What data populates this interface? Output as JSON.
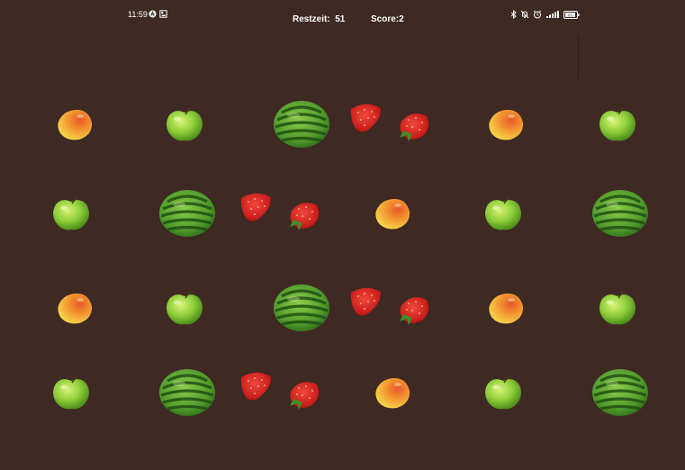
{
  "status_bar": {
    "time": "11:59",
    "left_icons": [
      "a-circle-icon",
      "gallery-icon"
    ],
    "right_icons": [
      "bluetooth-icon",
      "bell-off-icon",
      "alarm-icon",
      "signal-icon",
      "battery-icon"
    ],
    "battery_level": "83"
  },
  "hud": {
    "restzeit": "Restzeit:  51",
    "score": "Score:2"
  },
  "fruit_grid": {
    "rows": [
      [
        "peach",
        "apple",
        "watermelon",
        "strawberry",
        "peach",
        "apple"
      ],
      [
        "apple",
        "watermelon",
        "strawberry",
        "peach",
        "apple",
        "watermelon"
      ],
      [
        "peach",
        "apple",
        "watermelon",
        "strawberry",
        "peach",
        "apple"
      ],
      [
        "apple",
        "watermelon",
        "strawberry",
        "peach",
        "apple",
        "watermelon"
      ]
    ]
  },
  "colors": {
    "background": "#3e2923",
    "hud_text": "#ffffff"
  }
}
